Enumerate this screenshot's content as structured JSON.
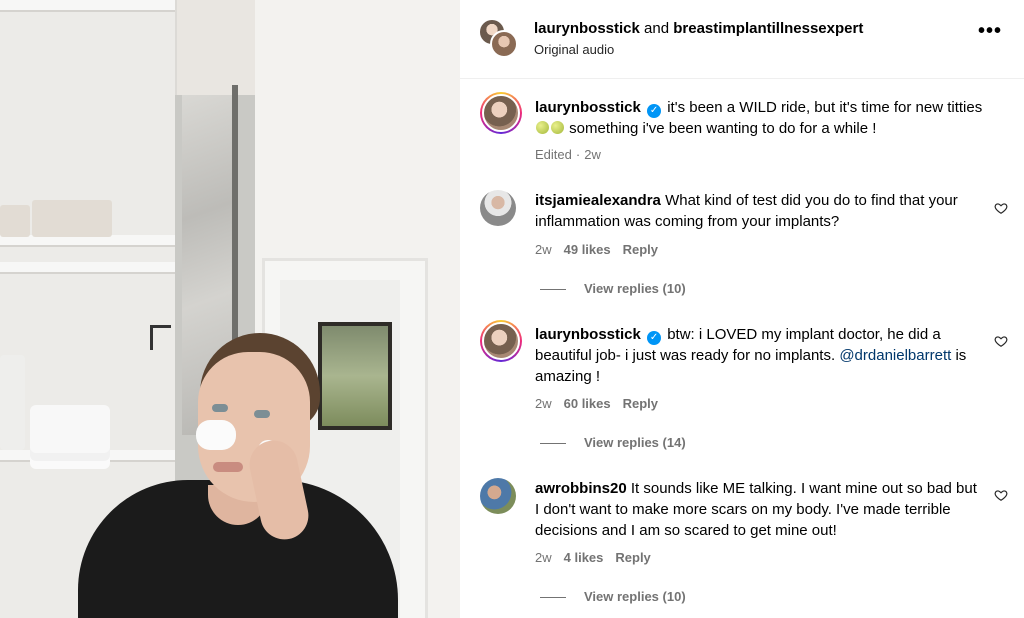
{
  "header": {
    "user1": "laurynbosstick",
    "joiner": " and ",
    "user2": "breastimplantillnessexpert",
    "audio": "Original audio",
    "more_icon": "more-horizontal-icon"
  },
  "caption": {
    "user": "laurynbosstick",
    "text_a": "it's been a WILD ride, but it's time for new titties",
    "text_b": "something i've been wanting to do for a while !",
    "edited": "Edited",
    "sep": "·",
    "time": "2w"
  },
  "comments": [
    {
      "user": "itsjamiealexandra",
      "text": "What kind of test did you do to find that your inflammation was coming from your implants?",
      "time": "2w",
      "likes": "49 likes",
      "reply": "Reply",
      "view_replies": "View replies (10)"
    },
    {
      "user": "laurynbosstick",
      "text": "btw: i LOVED my implant doctor, he did a beautiful job- i just was ready for no implants.",
      "mention": "@drdanielbarrett",
      "text_after": "is amazing !",
      "time": "2w",
      "likes": "60 likes",
      "reply": "Reply",
      "view_replies": "View replies (14)"
    },
    {
      "user": "awrobbins20",
      "text": "It sounds like ME talking. I want mine out so bad but I don't want to make more scars on my body. I've made terrible decisions and I am so scared to get mine out!",
      "time": "2w",
      "likes": "4 likes",
      "reply": "Reply",
      "view_replies": "View replies (10)"
    }
  ],
  "colors": {
    "verified": "#0095f6",
    "secondary_text": "#737373",
    "mention": "#00376b"
  }
}
